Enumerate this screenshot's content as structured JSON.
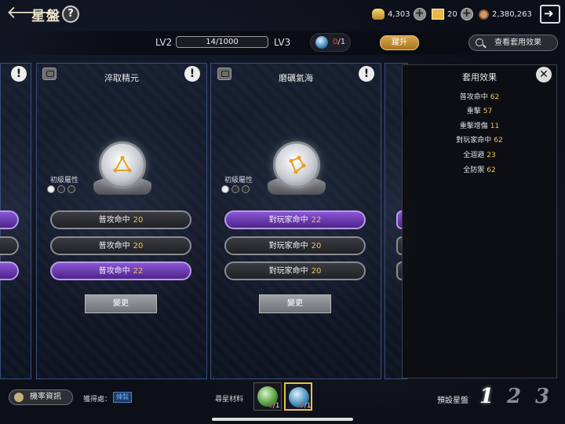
{
  "header": {
    "title": "星盤",
    "currencies": [
      {
        "icon": "gold-ingot-icon",
        "value": "4,303"
      },
      {
        "icon": "gold-bar-icon",
        "value": "20"
      },
      {
        "icon": "coin-icon",
        "value": "2,380,263"
      }
    ]
  },
  "level": {
    "current": "LV2",
    "next": "LV3",
    "progress_text": "14/1000",
    "progress_fraction": 0.014,
    "orb_have": "0",
    "orb_need": "/1",
    "upgrade_label": "躍升",
    "view_effects_label": "查看套用效果"
  },
  "panels": [
    {
      "name": "淬取精元",
      "attr_label": "初級屬性",
      "dots": [
        true,
        false,
        false
      ],
      "attrs": [
        {
          "label": "普攻命中",
          "value": "20",
          "style": "normal"
        },
        {
          "label": "普攻命中",
          "value": "20",
          "style": "normal"
        },
        {
          "label": "普攻命中",
          "value": "22",
          "style": "purple"
        }
      ],
      "change_label": "變更"
    },
    {
      "name": "磨礪氣海",
      "attr_label": "初級屬性",
      "dots": [
        true,
        false,
        false
      ],
      "attrs": [
        {
          "label": "對玩家命中",
          "value": "22",
          "style": "purple"
        },
        {
          "label": "對玩家命中",
          "value": "20",
          "style": "normal"
        },
        {
          "label": "對玩家命中",
          "value": "20",
          "style": "normal"
        }
      ],
      "change_label": "變更"
    }
  ],
  "effects_popup": {
    "title": "套用效果",
    "items": [
      {
        "label": "普攻命中",
        "value": "62"
      },
      {
        "label": "重擊",
        "value": "57"
      },
      {
        "label": "重擊增傷",
        "value": "11"
      },
      {
        "label": "對玩家命中",
        "value": "62"
      },
      {
        "label": "全迴避",
        "value": "23"
      },
      {
        "label": "全防禦",
        "value": "62"
      }
    ]
  },
  "footer": {
    "probability_label": "機率資訊",
    "obtain_label": "獲得處：",
    "obtain_tag": "煉製",
    "materials_label": "尋星材料",
    "materials": [
      {
        "icon": "green-orb-icon",
        "have": "0",
        "need": "/1"
      },
      {
        "icon": "blue-orb-icon",
        "have": "0",
        "need": "/1"
      }
    ],
    "preset_label": "預設星盤",
    "presets": [
      "1",
      "2",
      "3"
    ]
  }
}
